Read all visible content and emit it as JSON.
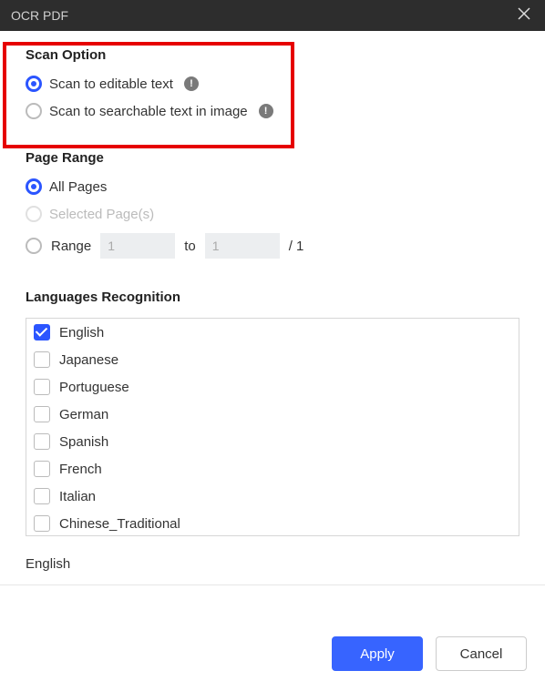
{
  "titlebar": {
    "title": "OCR PDF"
  },
  "scan": {
    "title": "Scan Option",
    "options": [
      {
        "label": "Scan to editable text",
        "checked": true,
        "info": true
      },
      {
        "label": "Scan to searchable text in image",
        "checked": false,
        "info": true
      }
    ]
  },
  "range": {
    "title": "Page Range",
    "all_label": "All Pages",
    "selected_label": "Selected Page(s)",
    "range_label": "Range",
    "from": "1",
    "to_label": "to",
    "to": "1",
    "total": "/ 1"
  },
  "languages": {
    "title": "Languages Recognition",
    "items": [
      {
        "label": "English",
        "checked": true
      },
      {
        "label": "Japanese",
        "checked": false
      },
      {
        "label": "Portuguese",
        "checked": false
      },
      {
        "label": "German",
        "checked": false
      },
      {
        "label": "Spanish",
        "checked": false
      },
      {
        "label": "French",
        "checked": false
      },
      {
        "label": "Italian",
        "checked": false
      },
      {
        "label": "Chinese_Traditional",
        "checked": false
      }
    ],
    "selected_summary": "English"
  },
  "footer": {
    "apply": "Apply",
    "cancel": "Cancel"
  }
}
